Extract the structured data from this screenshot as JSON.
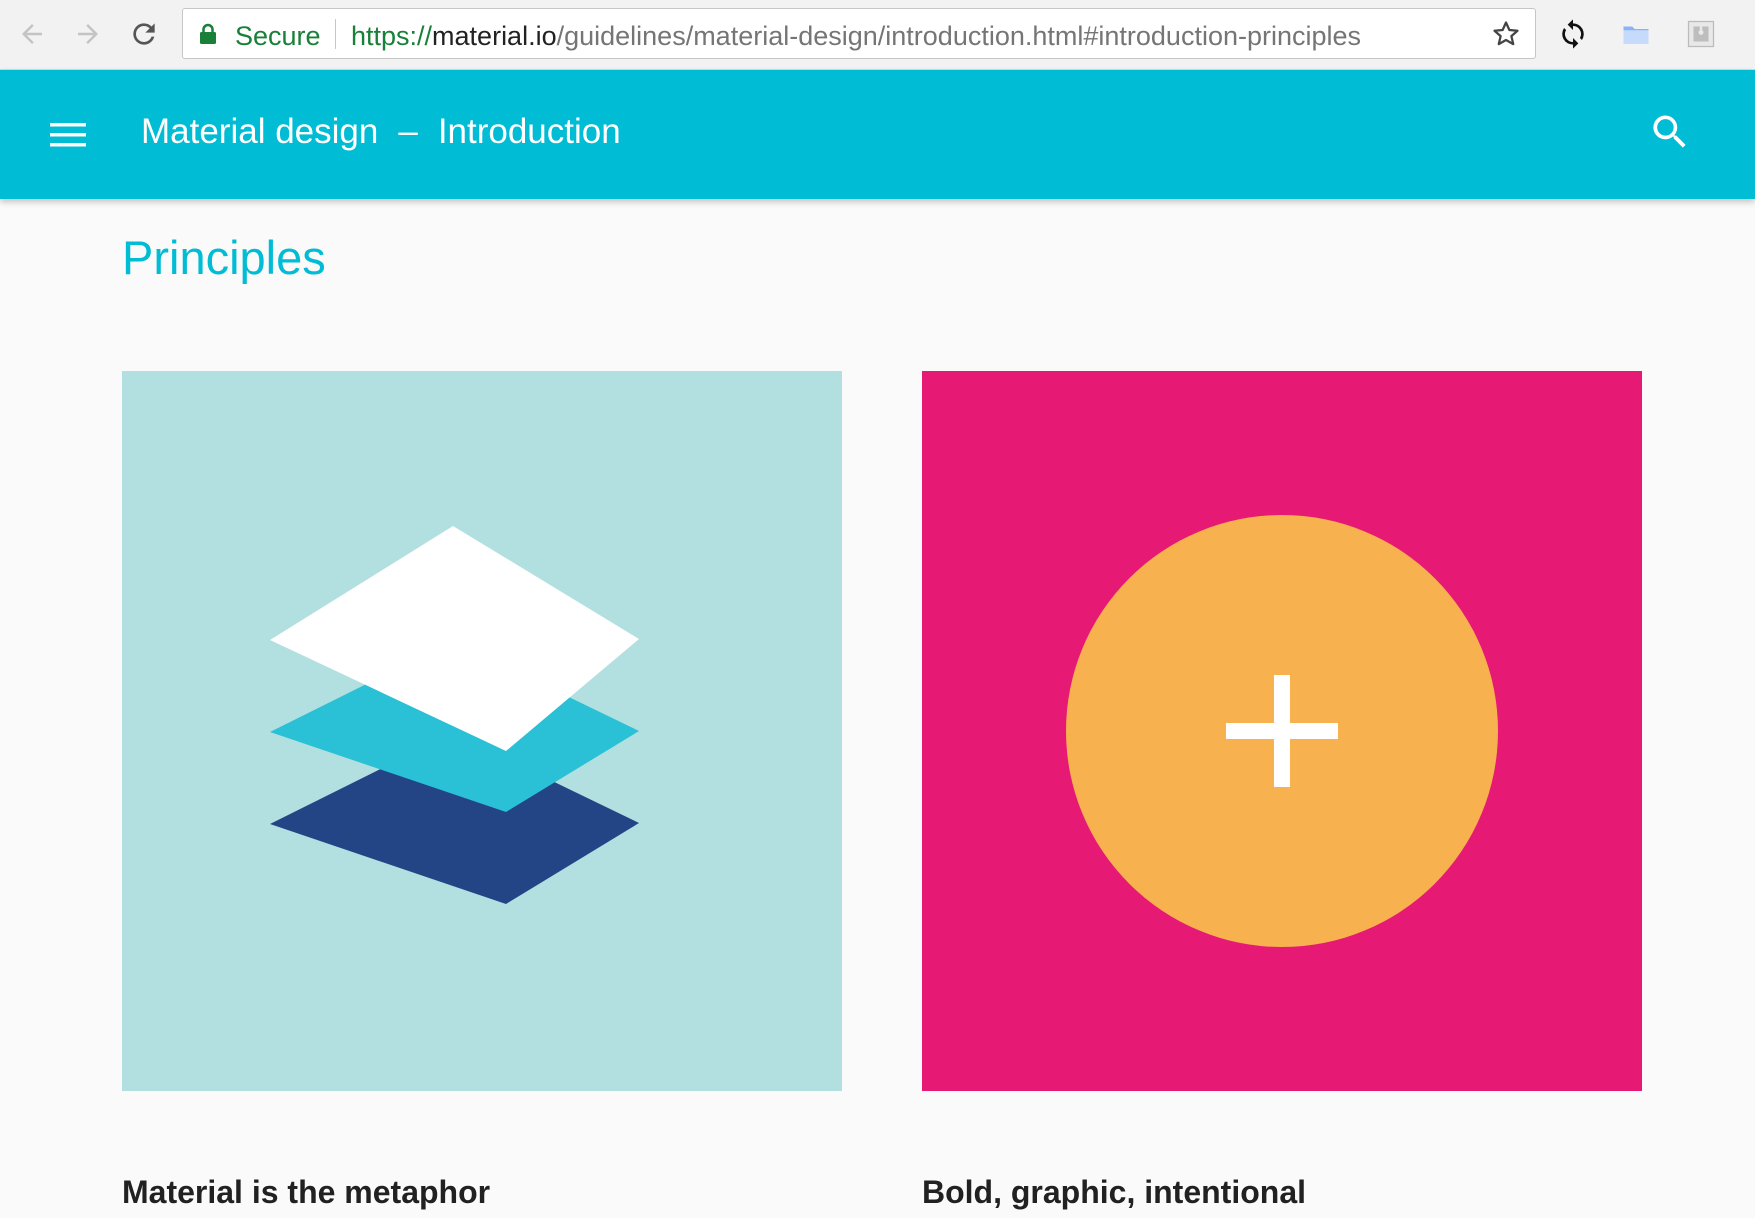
{
  "browser": {
    "secure_label": "Secure",
    "url_scheme": "https://",
    "url_host": "material.io",
    "url_path": "/guidelines/material-design/introduction.html#introduction-principles"
  },
  "appbar": {
    "title_section": "Material design",
    "title_separator": "–",
    "title_page": "Introduction",
    "color": "#00bcd4"
  },
  "main": {
    "section_title": "Principles",
    "cards": [
      {
        "heading": "Material is the metaphor",
        "background": "#b2dfe0",
        "illustration": "stacked-layers-icon"
      },
      {
        "heading": "Bold, graphic, intentional",
        "background": "#e61a74",
        "illustration": "add-circle-icon"
      }
    ]
  },
  "icons": [
    "back-arrow-icon",
    "forward-arrow-icon",
    "reload-icon",
    "lock-icon",
    "star-icon",
    "sync-icon",
    "folder-icon",
    "puzzle-icon",
    "menu-icon",
    "search-icon"
  ]
}
